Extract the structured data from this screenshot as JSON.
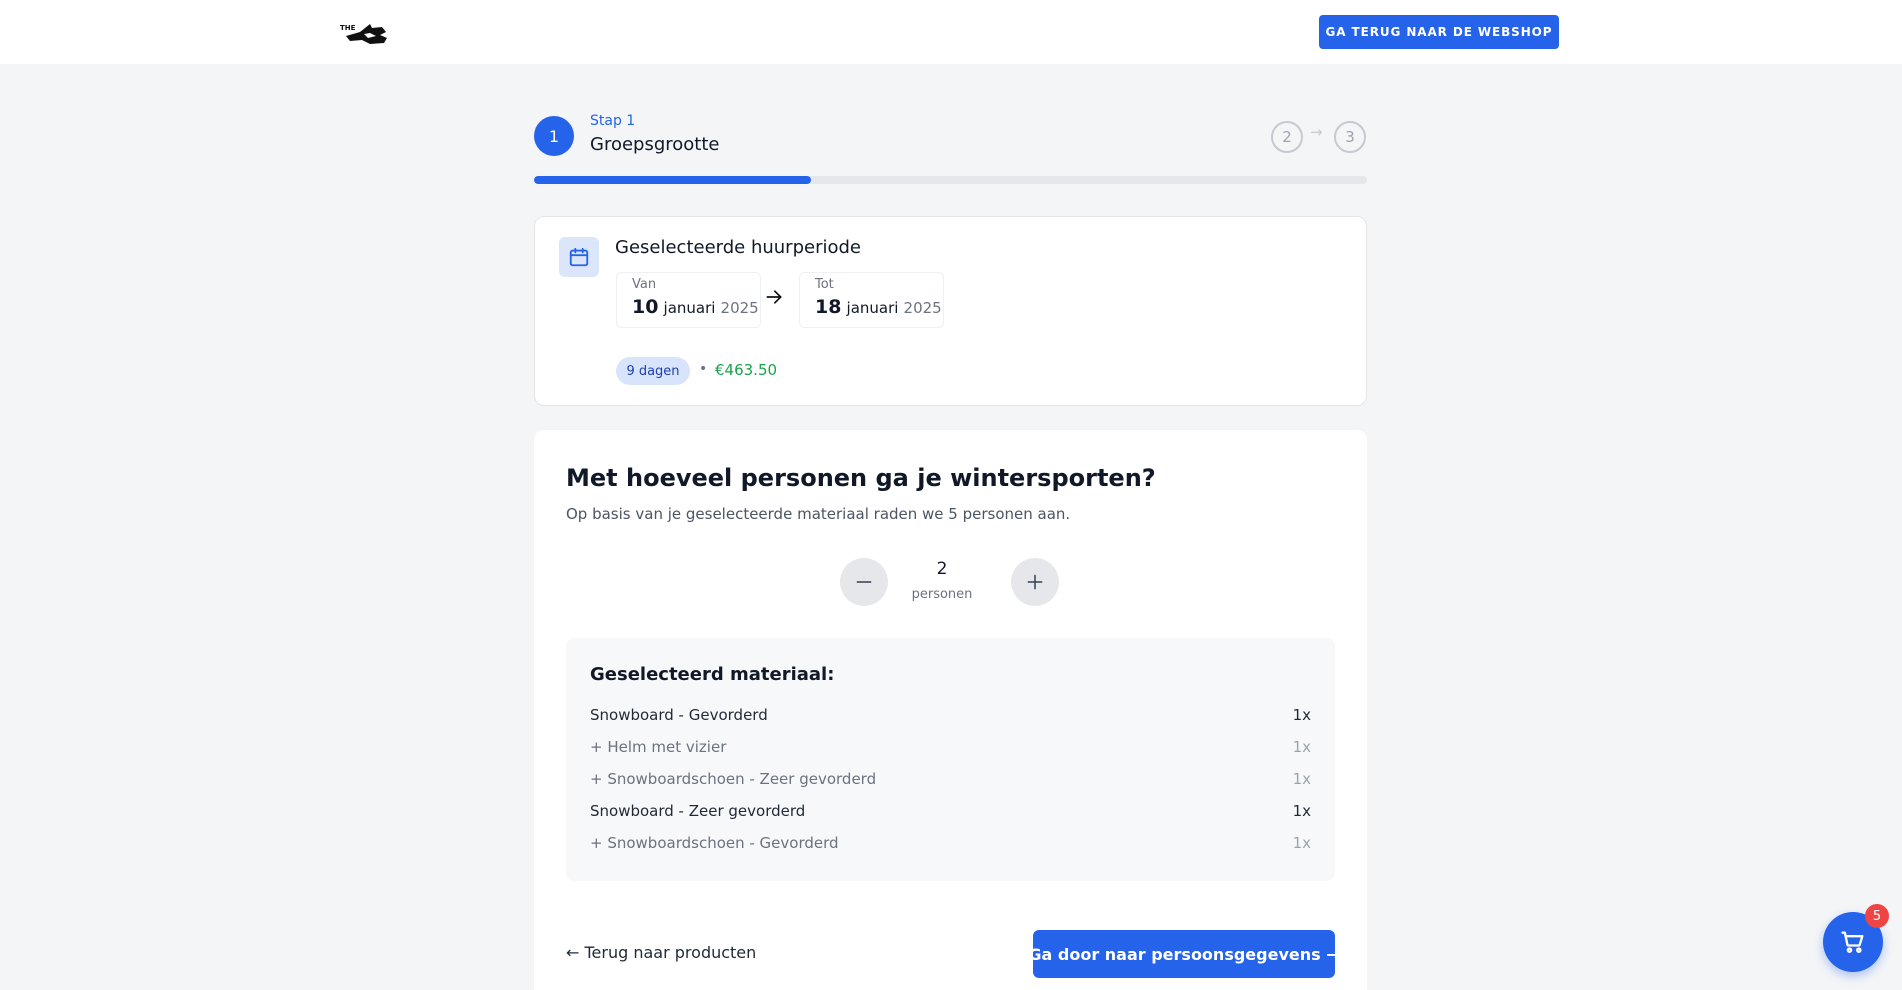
{
  "header": {
    "logo_icon": "brand-logo",
    "back_button_label": "GA TERUG NAAR DE WEBSHOP"
  },
  "steps": {
    "active_number": "1",
    "active_sub": "Stap 1",
    "active_title": "Groepsgrootte",
    "step2": "2",
    "step3": "3",
    "arrow": "→",
    "progress": 0.333
  },
  "period": {
    "icon": "calendar-icon",
    "title": "Geselecteerde huurperiode",
    "from_label": "Van",
    "from_day": "10",
    "from_month": "januari",
    "from_year": "2025",
    "to_label": "Tot",
    "to_day": "18",
    "to_month": "januari",
    "to_year": "2025",
    "days_badge": "9 dagen",
    "separator": "•",
    "price": "€463.50"
  },
  "group": {
    "question": "Met hoeveel personen ga je wintersporten?",
    "subtitle": "Op basis van je geselecteerde materiaal raden we 5 personen aan.",
    "count": "2",
    "count_label": "personen"
  },
  "material": {
    "title": "Geselecteerd materiaal:",
    "items": [
      {
        "name": "Snowboard - Gevorderd",
        "qty": "1x",
        "type": "main"
      },
      {
        "name": "+ Helm met vizier",
        "qty": "1x",
        "type": "sub"
      },
      {
        "name": "+ Snowboardschoen - Zeer gevorderd",
        "qty": "1x",
        "type": "sub"
      },
      {
        "name": "Snowboard - Zeer gevorderd",
        "qty": "1x",
        "type": "main"
      },
      {
        "name": "+ Snowboardschoen - Gevorderd",
        "qty": "1x",
        "type": "sub"
      }
    ]
  },
  "footer": {
    "back_label": "← Terug naar producten",
    "continue_label": "Ga door naar persoonsgegevens →"
  },
  "cart": {
    "icon": "cart-icon",
    "badge": "5"
  },
  "colors": {
    "accent": "#2563eb",
    "price": "#16a34a",
    "badge": "#ef4444"
  }
}
